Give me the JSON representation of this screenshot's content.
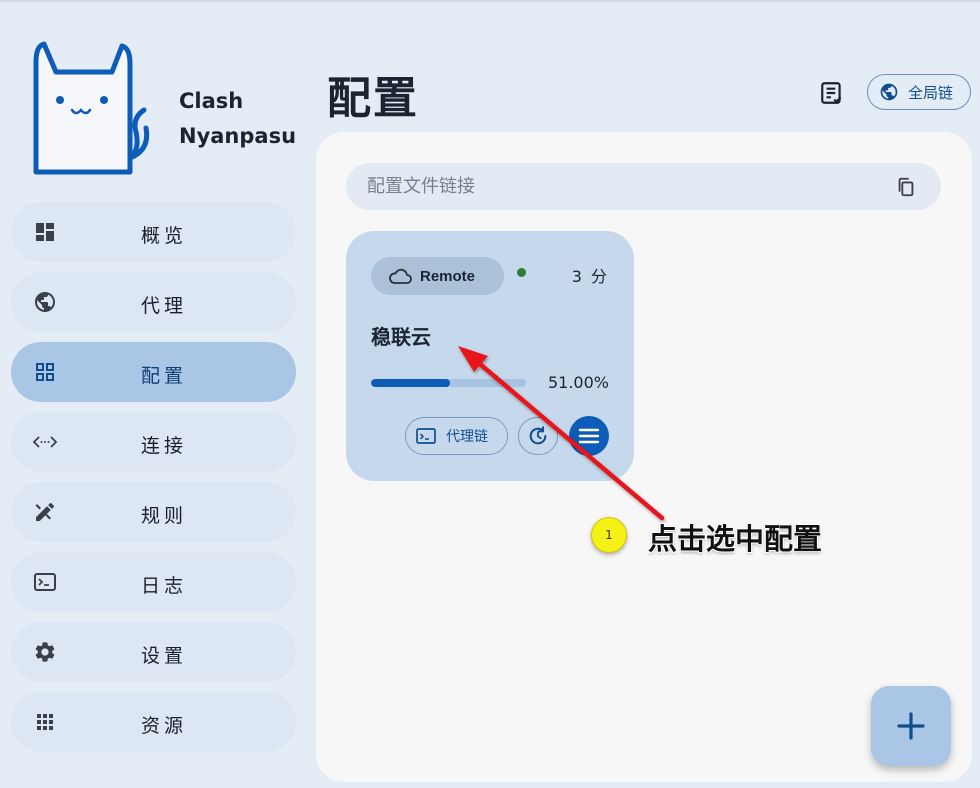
{
  "app": {
    "name_line1": "Clash",
    "name_line2": "Nyanpasu"
  },
  "sidebar": {
    "items": [
      {
        "label": "概览",
        "icon": "dashboard-icon"
      },
      {
        "label": "代理",
        "icon": "globe-icon"
      },
      {
        "label": "配置",
        "icon": "grid-icon",
        "active": true
      },
      {
        "label": "连接",
        "icon": "code-arrows-icon"
      },
      {
        "label": "规则",
        "icon": "design-rules-icon"
      },
      {
        "label": "日志",
        "icon": "terminal-icon"
      },
      {
        "label": "设置",
        "icon": "gear-icon"
      },
      {
        "label": "资源",
        "icon": "apps-grid-icon"
      }
    ]
  },
  "header": {
    "title": "配置",
    "global_chain_label": "全局链"
  },
  "search": {
    "placeholder": "配置文件链接"
  },
  "profile_card": {
    "type_label": "Remote",
    "time": "3 分",
    "name": "稳联云",
    "usage_percent_text": "51.00%",
    "usage_percent": 51.0,
    "chain_button_label": "代理链"
  },
  "annotation": {
    "step": "1",
    "text": "点击选中配置"
  },
  "colors": {
    "accent": "#0d5cb8",
    "active_nav": "#a9c6e6",
    "card_bg": "#c6d9ec",
    "status_green": "#2e7d32",
    "arrow": "#e8141b"
  }
}
